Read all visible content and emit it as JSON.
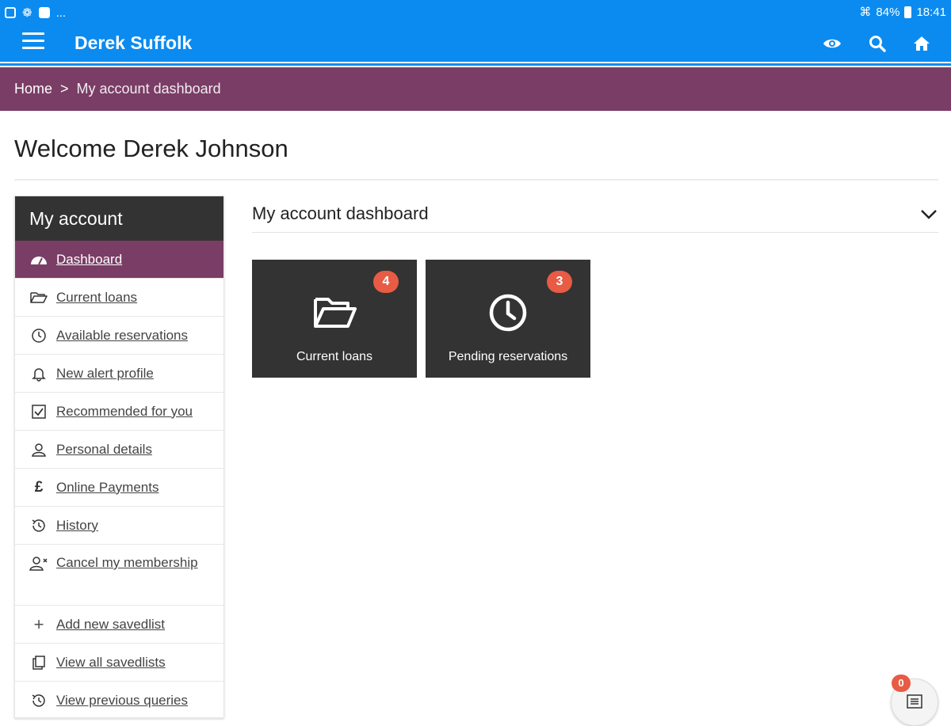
{
  "status_bar": {
    "left_text": "...",
    "battery": "84%",
    "time": "18:41"
  },
  "app_bar": {
    "title": "Derek Suffolk",
    "icons": [
      "eye-icon",
      "search-icon",
      "home-icon"
    ]
  },
  "breadcrumb": {
    "home": "Home",
    "separator": ">",
    "current": "My account dashboard"
  },
  "page": {
    "title": "Welcome Derek Johnson"
  },
  "sidebar": {
    "heading": "My account",
    "items": [
      {
        "label": "Dashboard",
        "icon": "dashboard-gauge-icon",
        "active": true
      },
      {
        "label": "Current loans",
        "icon": "folder-open-icon"
      },
      {
        "label": "Available reservations",
        "icon": "clock-icon"
      },
      {
        "label": "New alert profile",
        "icon": "bell-icon"
      },
      {
        "label": "Recommended for you",
        "icon": "checkbox-icon"
      },
      {
        "label": "Personal details",
        "icon": "user-icon"
      },
      {
        "label": "Online Payments",
        "icon": "pound-icon"
      },
      {
        "label": "History",
        "icon": "history-icon"
      },
      {
        "label": "Cancel my membership",
        "icon": "user-remove-icon"
      },
      {
        "label": "Add new savedlist",
        "icon": "plus-icon"
      },
      {
        "label": "View all savedlists",
        "icon": "copy-icon"
      },
      {
        "label": "View previous queries",
        "icon": "history-icon"
      }
    ]
  },
  "panel": {
    "title": "My account dashboard",
    "tiles": [
      {
        "label": "Current loans",
        "count": "4",
        "icon": "folder-open-icon"
      },
      {
        "label": "Pending reservations",
        "count": "3",
        "icon": "clock-icon"
      }
    ]
  },
  "fab": {
    "count": "0",
    "icon": "list-icon"
  },
  "colors": {
    "primary_blue": "#0b8bf0",
    "accent_purple": "#7a3d66",
    "dark_tile": "#333333",
    "badge_red": "#e85b45"
  }
}
